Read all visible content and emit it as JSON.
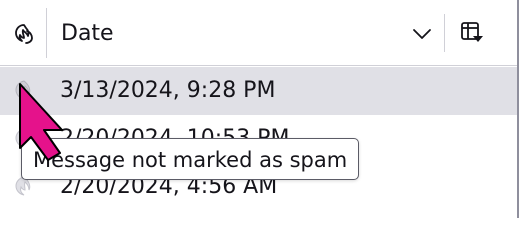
{
  "header": {
    "date_label": "Date",
    "junk_icon": "junk-status-icon",
    "sort_icon": "chevron-down-icon",
    "picker_icon": "column-picker-icon"
  },
  "rows": [
    {
      "date": "3/13/2024, 9:28 PM",
      "selected": true
    },
    {
      "date": "2/20/2024, 10:53 PM",
      "selected": false
    },
    {
      "date": "2/20/2024, 4:56 AM",
      "selected": false
    }
  ],
  "tooltip": {
    "text": "Message not marked as spam"
  },
  "cursor": {
    "icon": "pointer-arrow-icon",
    "color": "#e5128b"
  },
  "colors": {
    "selected_row": "#e0e0e6",
    "header_border": "#d0d0d7",
    "text": "#15141a",
    "icon": "#cfcfd6"
  }
}
